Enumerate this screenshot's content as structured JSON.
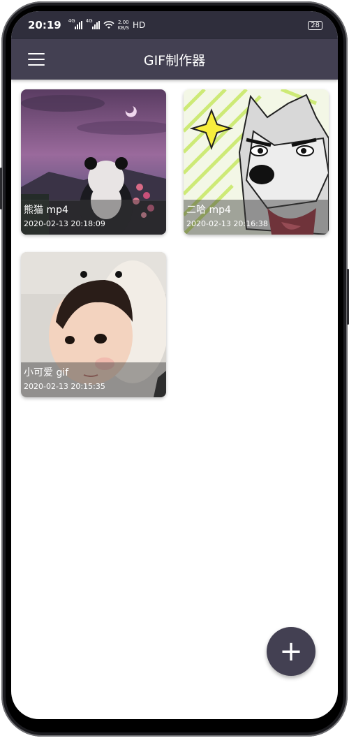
{
  "status_bar": {
    "time": "20:19",
    "network_1": "4G",
    "network_2": "4G",
    "speed_value": "2.00",
    "speed_unit": "KB/S",
    "hd": "HD",
    "battery": "28"
  },
  "app_bar": {
    "title": "GIF制作器",
    "menu_icon": "hamburger-menu-icon"
  },
  "items": [
    {
      "name": "熊猫 mp4",
      "date": "2020-02-13 20:18:09"
    },
    {
      "name": "二哈 mp4",
      "date": "2020-02-13 20:16:38"
    },
    {
      "name": "小可爱 gif",
      "date": "2020-02-13 20:15:35"
    }
  ],
  "fab": {
    "icon": "plus-icon",
    "label": "+"
  },
  "colors": {
    "status_bar": "#2f2e3c",
    "app_bar": "#434052",
    "fab": "#434052",
    "background": "#ffffff"
  }
}
